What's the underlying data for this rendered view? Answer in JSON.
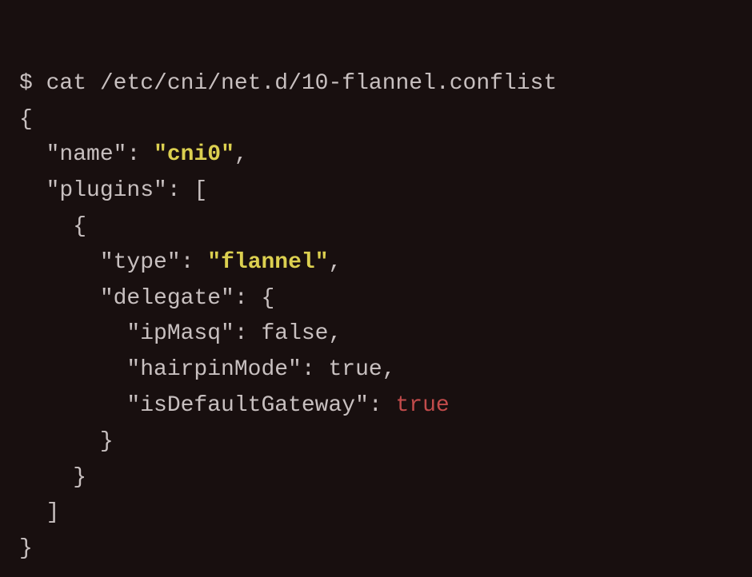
{
  "prompt_symbol": "$",
  "command": "cat /etc/cni/net.d/10-flannel.conflist",
  "json": {
    "open_brace": "{",
    "name_key": "\"name\"",
    "name_value": "\"cni0\"",
    "plugins_key": "\"plugins\"",
    "open_bracket": "[",
    "plugin_open": "{",
    "type_key": "\"type\"",
    "type_value": "\"flannel\"",
    "delegate_key": "\"delegate\"",
    "delegate_open": "{",
    "ipmasq_key": "\"ipMasq\"",
    "ipmasq_value": "false",
    "hairpin_key": "\"hairpinMode\"",
    "hairpin_value": "true",
    "gateway_key": "\"isDefaultGateway\"",
    "gateway_value": "true",
    "delegate_close": "}",
    "plugin_close": "}",
    "close_bracket": "]",
    "close_brace": "}",
    "colon": ":",
    "comma": ","
  }
}
